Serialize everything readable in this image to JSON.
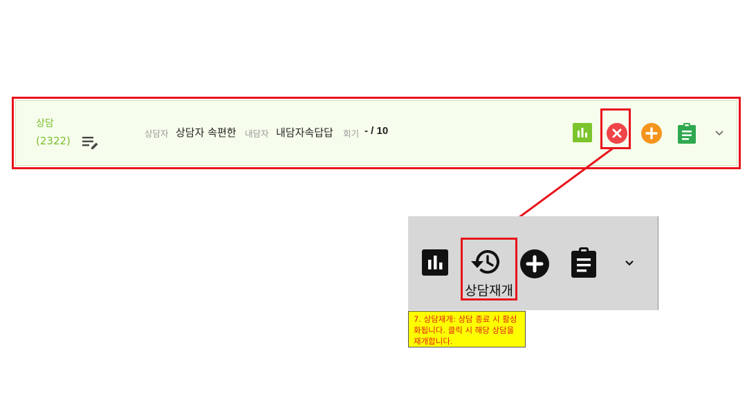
{
  "row": {
    "title": "상담",
    "count": "(2322)",
    "counselor_label": "상담자",
    "counselor_value": "상담자 속편한",
    "client_label": "내담자",
    "client_value": "내담자속답답",
    "session_label": "회기",
    "session_value": "- / 10",
    "icons": [
      "edit-list-icon",
      "chart-icon",
      "close-icon",
      "plus-icon",
      "clipboard-icon",
      "chevron-down-icon"
    ]
  },
  "panel": {
    "restore_label": "상담재개",
    "icons": [
      "chart-icon",
      "history-icon",
      "plus-icon",
      "clipboard-icon",
      "chevron-down-icon"
    ]
  },
  "note": {
    "text": "7. 상담재개: 상담 종료 시 활성화됩니다. 클릭 시 해당 상담을 재개합니다."
  },
  "colors": {
    "highlight": "#e8121b",
    "brand_green": "#7cbd2e",
    "close_red": "#ef4448",
    "add_orange": "#f5941c",
    "note_bg": "#fdff00"
  }
}
